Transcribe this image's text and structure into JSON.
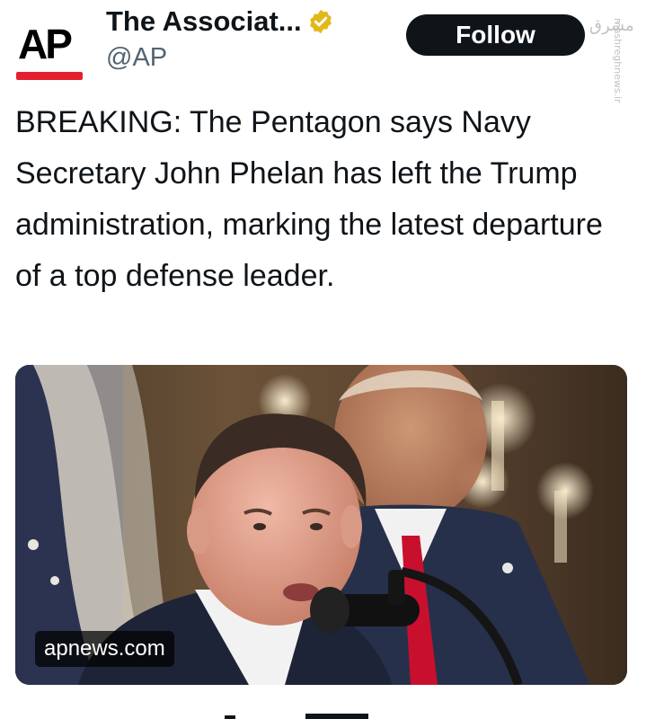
{
  "account": {
    "avatar_text": "AP",
    "display_name": "The Associat...",
    "handle": "@AP",
    "verified": true,
    "verified_badge_color": "#e2b719"
  },
  "follow_button": {
    "label": "Follow"
  },
  "tweet": {
    "text": "BREAKING: The Pentagon says Navy Secretary John Phelan has left the Trump administration, marking the latest departure of a top defense leader."
  },
  "media": {
    "link_domain": "apnews.com"
  },
  "watermark": {
    "logo": "مشرق",
    "site": "mashreghnews.ir"
  },
  "colors": {
    "ap_red": "#e5202e",
    "follow_bg": "#0f1419",
    "text_primary": "#0f1419",
    "text_secondary": "#536471"
  }
}
